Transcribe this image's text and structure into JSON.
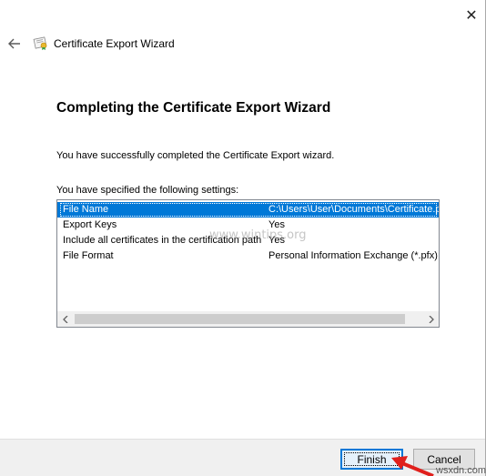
{
  "window": {
    "title": "Certificate Export Wizard",
    "close_glyph": "✕",
    "back_glyph": "←"
  },
  "page": {
    "heading": "Completing the Certificate Export Wizard",
    "success_text": "You have successfully completed the Certificate Export wizard.",
    "settings_label": "You have specified the following settings:"
  },
  "settings": [
    {
      "key": "File Name",
      "value": "C:\\Users\\User\\Documents\\Certificate.pfx"
    },
    {
      "key": "Export Keys",
      "value": "Yes"
    },
    {
      "key": "Include all certificates in the certification path",
      "value": "Yes"
    },
    {
      "key": "File Format",
      "value": "Personal Information Exchange (*.pfx)"
    }
  ],
  "watermark": "www.wintips.org",
  "footer": {
    "finish_label": "Finish",
    "cancel_label": "Cancel"
  },
  "corner_watermark": "wsxdn.com",
  "colors": {
    "selection": "#0078d7",
    "arrow": "#e0201c"
  },
  "icons": {
    "back": "back-arrow-icon",
    "certificate": "certificate-icon",
    "close": "close-icon"
  }
}
